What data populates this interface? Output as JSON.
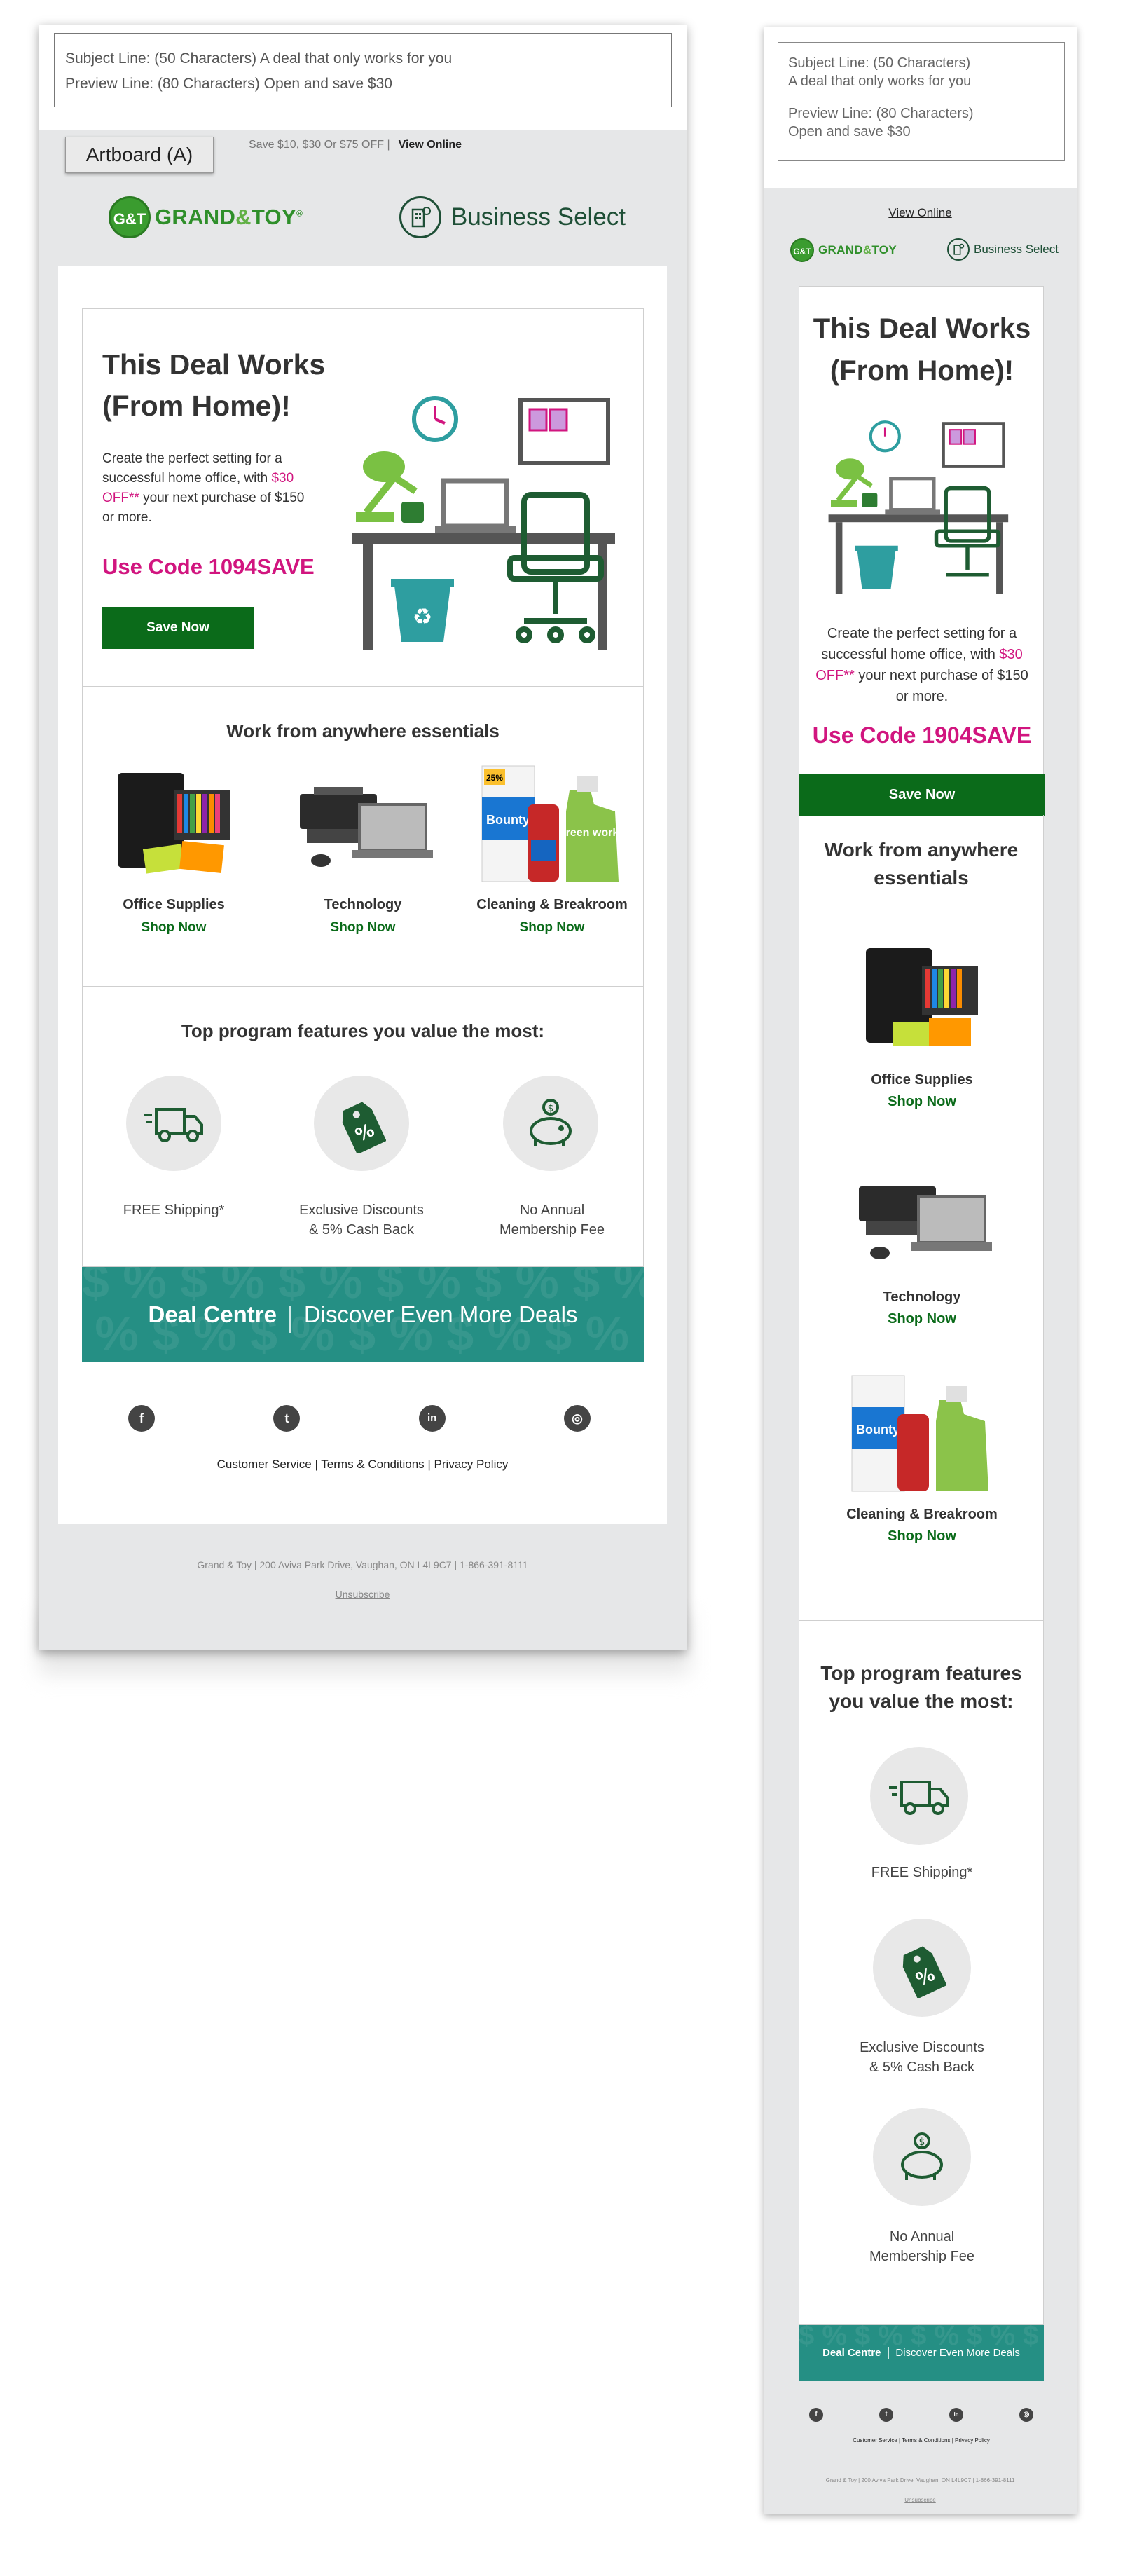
{
  "artboard_label": "Artboard (A)",
  "subject": {
    "subject_label": "Subject Line:",
    "subject_text": "(50 Characters) A deal that only works for you",
    "subject_text_short": "(50 Characters)",
    "subject_text_line2": "A deal that only works for you",
    "preview_label": "Preview Line:",
    "preview_text": "(80 Characters) Open and save $30",
    "preview_text_short": "(80 Characters)",
    "preview_text_line2": "Open and save $30"
  },
  "preheader": {
    "offer": "Save $10, $30 Or $75 OFF |",
    "view_online": "View Online"
  },
  "brand": {
    "gt_monogram": "G&T",
    "gt_name_part1": "GRAND",
    "gt_name_amp": "&",
    "gt_name_part2": "TOY",
    "gt_reg": "®",
    "business_select": "Business Select",
    "green": "#3a9c2f",
    "dark_green": "#1e4f36"
  },
  "hero": {
    "title_line1": "This Deal Works",
    "title_line2": "(From Home)!",
    "body_pre": "Create the perfect setting for a successful home office, with",
    "body_offer": "$30 OFF**",
    "body_post": "your next purchase of $150 or more.",
    "code_desktop": "Use Code 1094SAVE",
    "code_mobile": "Use Code 1904SAVE",
    "cta": "Save Now",
    "accent_pink": "#d1157f",
    "cta_color": "#0b6b1a"
  },
  "essentials": {
    "title": "Work from anywhere essentials",
    "title_line1": "Work from anywhere",
    "title_line2": "essentials",
    "items": [
      {
        "name": "Office Supplies",
        "cta": "Shop Now",
        "icon": "office-supplies-image"
      },
      {
        "name": "Technology",
        "cta": "Shop Now",
        "icon": "technology-image"
      },
      {
        "name": "Cleaning & Breakroom",
        "cta": "Shop Now",
        "icon": "cleaning-image"
      }
    ],
    "bounty_label": "Bounty",
    "bounty_badge": "25%",
    "greenworks_label": "green works"
  },
  "features": {
    "title": "Top program features you value the most:",
    "title_line1": "Top program features",
    "title_line2": "you value the most:",
    "items": [
      {
        "label_line1": "FREE Shipping*",
        "label_line2": "",
        "icon": "truck-icon"
      },
      {
        "label_line1": "Exclusive Discounts",
        "label_line2": "& 5% Cash Back",
        "icon": "discount-tag-icon"
      },
      {
        "label_line1": "No Annual",
        "label_line2": "Membership Fee",
        "icon": "piggy-bank-icon"
      }
    ]
  },
  "deal_banner": {
    "bold": "Deal Centre",
    "text": "Discover Even More Deals",
    "color": "#258f84",
    "pattern": "$ % $ % $ % $ % $ % $ % $ %"
  },
  "social": [
    {
      "name": "facebook-icon",
      "glyph": "f"
    },
    {
      "name": "twitter-icon",
      "glyph": "t"
    },
    {
      "name": "linkedin-icon",
      "glyph": "in"
    },
    {
      "name": "instagram-icon",
      "glyph": "◎"
    }
  ],
  "footer": {
    "links": "Customer Service | Terms & Conditions | Privacy Policy",
    "address": "Grand & Toy | 200 Aviva Park Drive, Vaughan, ON L4L9C7 | 1-866-391-8111",
    "unsubscribe": "Unsubscribe"
  }
}
